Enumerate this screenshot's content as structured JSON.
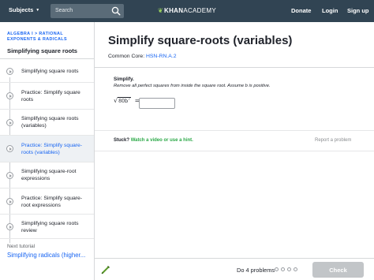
{
  "header": {
    "subjects_label": "Subjects",
    "search_placeholder": "Search",
    "logo_prefix": "KHAN",
    "logo_suffix": "ACADEMY",
    "donate": "Donate",
    "login": "Login",
    "signup": "Sign up"
  },
  "sidebar": {
    "breadcrumb": "Algebra I > Rational exponents & radicals",
    "title": "Simplifying square roots",
    "items": [
      {
        "label": "Simplifying square roots"
      },
      {
        "label": "Practice: Simplify square roots"
      },
      {
        "label": "Simplifying square roots (variables)"
      },
      {
        "label": "Practice: Simplify square-roots (variables)"
      },
      {
        "label": "Simplifying square-root expressions"
      },
      {
        "label": "Practice: Simplify square-root expressions"
      },
      {
        "label": "Simplifying square roots review"
      }
    ],
    "next_label": "Next tutorial",
    "next_link": "Simplifying radicals (higher..."
  },
  "main": {
    "title": "Simplify square-roots (variables)",
    "common_core_label": "Common Core: ",
    "common_core_code": "HSN-RN.A.2",
    "question_heading": "Simplify.",
    "question_instructions": "Remove all perfect squares from inside the square root. Assume b is positive.",
    "expression_radicand": "80b",
    "expression_exponent": "7",
    "equals": "=",
    "stuck_label": "Stuck?",
    "stuck_link": "Watch a video or use a hint.",
    "report": "Report a problem"
  },
  "footer": {
    "progress_text": "Do 4 problems",
    "check_label": "Check"
  },
  "colors": {
    "header_bg": "#314453",
    "link_blue": "#1865f2",
    "hint_green": "#2aa846",
    "check_disabled": "#c2c5c8"
  }
}
